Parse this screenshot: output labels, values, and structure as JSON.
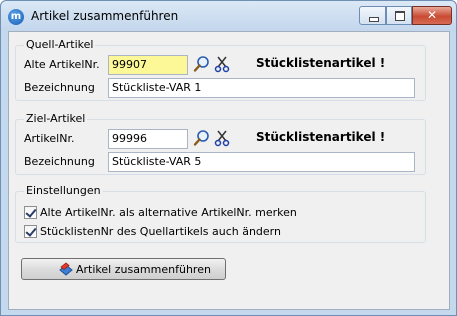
{
  "window": {
    "title": "Artikel zusammenführen",
    "app_icon_letter": "m",
    "close_glyph": "✕"
  },
  "quell": {
    "legend": "Quell-Artikel",
    "nr_label": "Alte ArtikelNr.",
    "nr_value": "99907",
    "bez_label": "Bezeichnung",
    "bez_value": "Stückliste-VAR 1",
    "warning": "Stücklistenartikel !"
  },
  "ziel": {
    "legend": "Ziel-Artikel",
    "nr_label": "ArtikelNr.",
    "nr_value": "99996",
    "bez_label": "Bezeichnung",
    "bez_value": "Stückliste-VAR 5",
    "warning": "Stücklistenartikel !"
  },
  "einstellungen": {
    "legend": "Einstellungen",
    "options": [
      {
        "label": "Alte ArtikelNr. als alternative ArtikelNr. merken",
        "checked": true
      },
      {
        "label": "StücklistenNr des Quellartikels auch ändern",
        "checked": true
      }
    ]
  },
  "actions": {
    "merge_label": "Artikel zusammenführen"
  },
  "icons": {
    "search": "magnifier-icon",
    "tool": "scissors-icon",
    "merge": "merge-icon"
  }
}
